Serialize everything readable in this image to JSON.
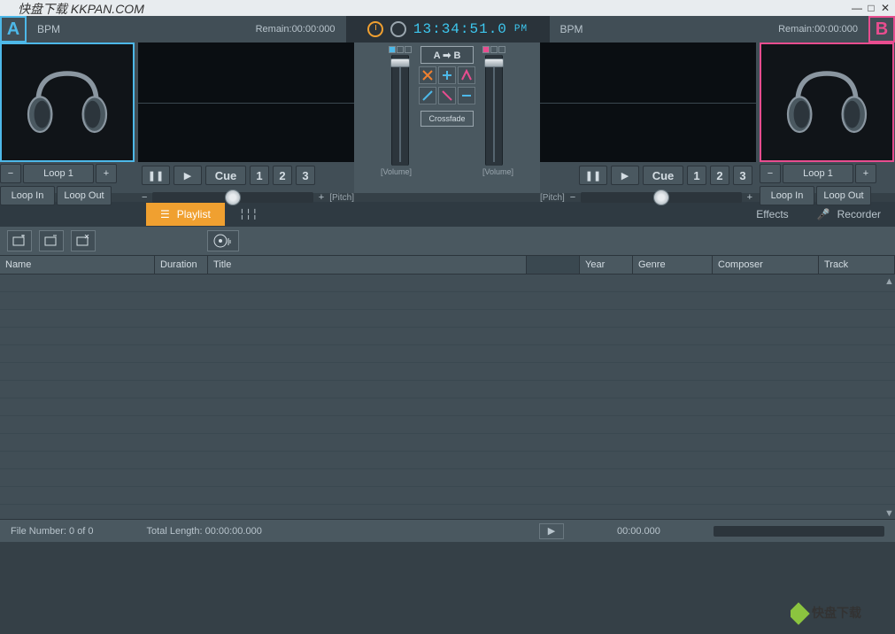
{
  "watermark": "快盘下载 KKPAN.COM",
  "deckA": {
    "tag": "A",
    "bpm": "BPM",
    "remain_label": "Remain:",
    "remain_value": "00:00:000",
    "loop_minus": "−",
    "loop_label": "Loop 1",
    "loop_plus": "+",
    "loop_in": "Loop In",
    "loop_out": "Loop Out",
    "pause": "❚❚",
    "play": "▶",
    "cue": "Cue",
    "n1": "1",
    "n2": "2",
    "n3": "3",
    "pitch": "[Pitch]",
    "pitch_minus": "−",
    "pitch_plus": "+"
  },
  "deckB": {
    "tag": "B",
    "bpm": "BPM",
    "remain_label": "Remain:",
    "remain_value": "00:00:000",
    "loop_minus": "−",
    "loop_label": "Loop 1",
    "loop_plus": "+",
    "loop_in": "Loop In",
    "loop_out": "Loop Out",
    "pause": "❚❚",
    "play": "▶",
    "cue": "Cue",
    "n1": "1",
    "n2": "2",
    "n3": "3",
    "pitch": "[Pitch]",
    "pitch_minus": "−",
    "pitch_plus": "+"
  },
  "clock": {
    "time": "13:34:51.0",
    "ampm": "PM"
  },
  "mixer": {
    "ab": "A ➡ B",
    "crossfade": "Crossfade",
    "volume": "[Volume]"
  },
  "tabs": {
    "playlist": "Playlist",
    "effects": "Effects",
    "recorder": "Recorder"
  },
  "grid": {
    "name": "Name",
    "duration": "Duration",
    "title": "Title",
    "year": "Year",
    "genre": "Genre",
    "composer": "Composer",
    "track": "Track"
  },
  "status": {
    "file_num": "File Number: 0 of 0",
    "total_len": "Total Length: 00:00:00.000",
    "pos": "00:00.000"
  },
  "watermark2": "快盘下载"
}
